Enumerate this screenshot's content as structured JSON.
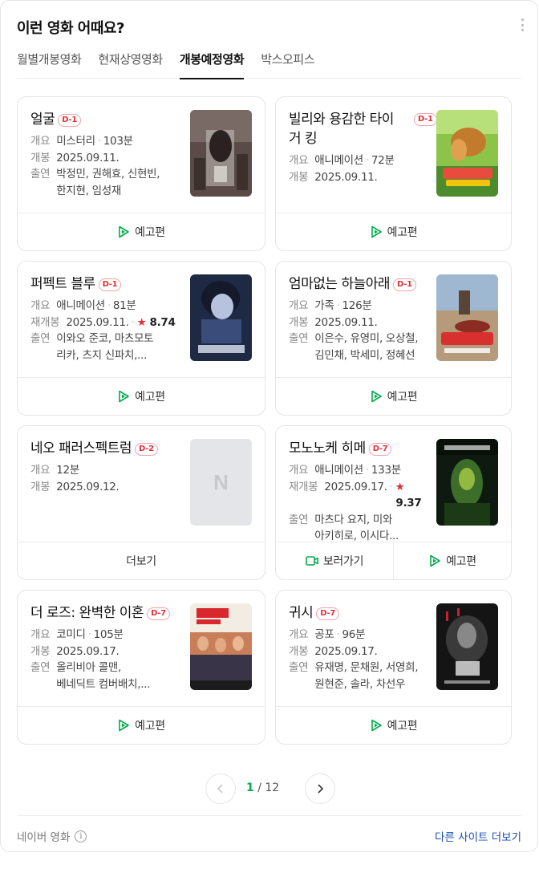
{
  "header": {
    "title": "이런 영화 어때요?"
  },
  "tabs": [
    {
      "label": "월별개봉영화"
    },
    {
      "label": "현재상영영화"
    },
    {
      "label": "개봉예정영화"
    },
    {
      "label": "박스오피스"
    }
  ],
  "labels": {
    "overview": "개요",
    "release": "개봉",
    "rerelease": "재개봉",
    "cast": "출연",
    "trailer": "예고편",
    "more": "더보기",
    "watch": "보러가기",
    "star": "★"
  },
  "movies": [
    {
      "title": "얼굴",
      "badge": "D-1",
      "genre": "미스터리",
      "runtime": "103분",
      "date": "2025.09.11.",
      "cast_line1": "박정민, 권해효, 신현빈,",
      "cast_line2": "한지현, 임성재"
    },
    {
      "title": "빌리와 용감한 타이",
      "title2": "거 킹",
      "badge": "D-1",
      "genre": "애니메이션",
      "runtime": "72분",
      "date": "2025.09.11."
    },
    {
      "title": "퍼펙트 블루",
      "badge": "D-1",
      "genre": "애니메이션",
      "runtime": "81분",
      "date": "2025.09.11.",
      "score": "8.74",
      "cast_line1": "이와오 준코, 마츠모토",
      "cast_line2": "리카, 츠지 신파치,..."
    },
    {
      "title": "엄마없는 하늘아래",
      "badge": "D-1",
      "genre": "가족",
      "runtime": "126분",
      "date": "2025.09.11.",
      "cast_line1": "이은수, 유영미, 오상철,",
      "cast_line2": "김민채, 박세미, 정혜선"
    },
    {
      "title": "네오 패러스펙트럼",
      "badge": "D-2",
      "runtime": "12분",
      "date": "2025.09.12.",
      "poster_placeholder": "N"
    },
    {
      "title": "모노노케 히메",
      "badge": "D-7",
      "genre": "애니메이션",
      "runtime": "133분",
      "date": "2025.09.17.",
      "score": "9.37",
      "cast_line1": "마츠다 요지, 미와",
      "cast_line2": "아키히로, 이시다..."
    },
    {
      "title": "더 로즈: 완벽한 이혼",
      "badge": "D-7",
      "genre": "코미디",
      "runtime": "105분",
      "date": "2025.09.17.",
      "cast_line1": "올리비아 콜맨,",
      "cast_line2": "베네딕트 컴버배치,..."
    },
    {
      "title": "귀시",
      "badge": "D-7",
      "genre": "공포",
      "runtime": "96분",
      "date": "2025.09.17.",
      "cast_line1": "유재명, 문채원, 서영희,",
      "cast_line2": "원현준, 솔라, 차선우"
    }
  ],
  "pagination": {
    "current": "1",
    "separator": "/",
    "total": "12"
  },
  "footer": {
    "source": "네이버 영화",
    "info": "i",
    "other_link": "다른 사이트 더보기"
  },
  "colors": {
    "accent_green": "#03a94d",
    "badge_red": "#e0303a",
    "link_blue": "#1a4fb3"
  }
}
